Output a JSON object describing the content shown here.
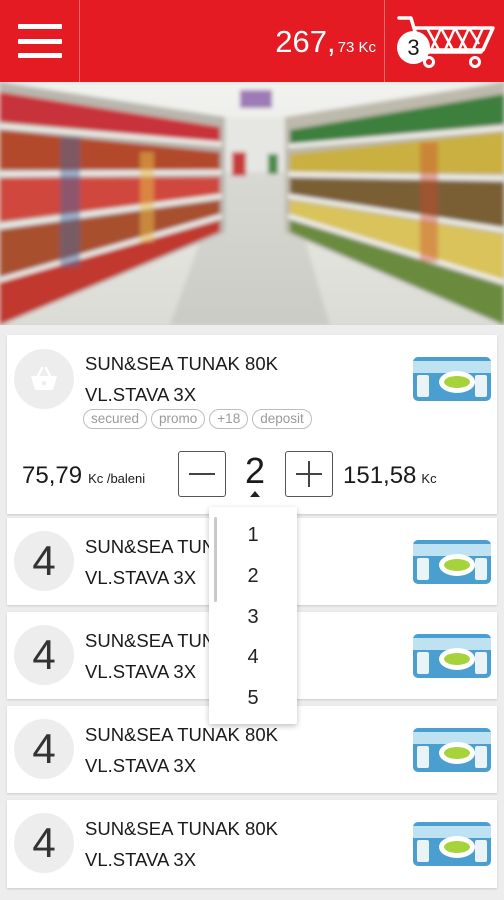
{
  "header": {
    "total_main": "267,",
    "total_decimal": "73 Kc",
    "cart_count": "3"
  },
  "colors": {
    "brand_red": "#e41b23"
  },
  "icons": {
    "menu": "hamburger-menu-icon",
    "cart": "shopping-cart-icon",
    "basket": "basket-icon"
  },
  "expanded_item": {
    "name_line1": "SUN&SEA TUNAK 80K",
    "name_line2": "VL.STAVA 3X",
    "tags": [
      "secured",
      "promo",
      "+18",
      "deposit"
    ],
    "unit_price": "75,79",
    "unit_label": "Kc /baleni",
    "quantity": "2",
    "line_total": "151,58",
    "line_total_unit": "Kc"
  },
  "quantity_options": [
    "1",
    "2",
    "3",
    "4",
    "5"
  ],
  "items": [
    {
      "qty": "4",
      "name_line1": "SUN&SEA TUNAK 80K",
      "name_line2": "VL.STAVA 3X"
    },
    {
      "qty": "4",
      "name_line1": "SUN&SEA TUNAK 80K",
      "name_line2": "VL.STAVA 3X"
    },
    {
      "qty": "4",
      "name_line1": "SUN&SEA TUNAK 80K",
      "name_line2": "VL.STAVA 3X"
    },
    {
      "qty": "4",
      "name_line1": "SUN&SEA TUNAK 80K",
      "name_line2": "VL.STAVA 3X"
    }
  ]
}
